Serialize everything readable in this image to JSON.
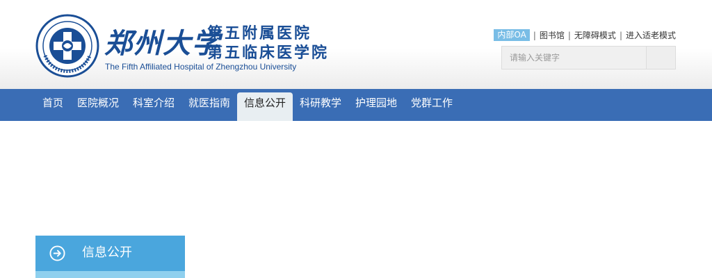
{
  "header": {
    "logo_calligraphy": "郑州大学",
    "logo_cn_line1": "第五附属医院",
    "logo_cn_line2": "第五临床医学院",
    "logo_en": "The Fifth Affiliated Hospital of Zhengzhou University",
    "seal_text_outer": "The Fifth Affiliated Hospital of Zhengzhou University",
    "seal_text_inner": "郑州大学第五附属医院"
  },
  "toplinks": {
    "oa": "内部OA",
    "separator": "|",
    "library": "图书馆",
    "accessible": "无障碍模式",
    "elderly": "进入适老模式"
  },
  "search": {
    "placeholder": "请输入关键字",
    "button_icon": "search-icon"
  },
  "nav": {
    "items": [
      {
        "label": "首页"
      },
      {
        "label": "医院概况"
      },
      {
        "label": "科室介绍"
      },
      {
        "label": "就医指南"
      },
      {
        "label": "信息公开"
      },
      {
        "label": "科研教学"
      },
      {
        "label": "护理园地"
      },
      {
        "label": "党群工作"
      }
    ],
    "active_index": 4
  },
  "sidebar": {
    "title": "信息公开",
    "icon": "arrow-right-circle-icon"
  },
  "colors": {
    "brand": "#1a4e96",
    "nav_bg": "#3a6db5",
    "oa_badge": "#79bde6",
    "side_title_bg": "#4aa6dd"
  }
}
